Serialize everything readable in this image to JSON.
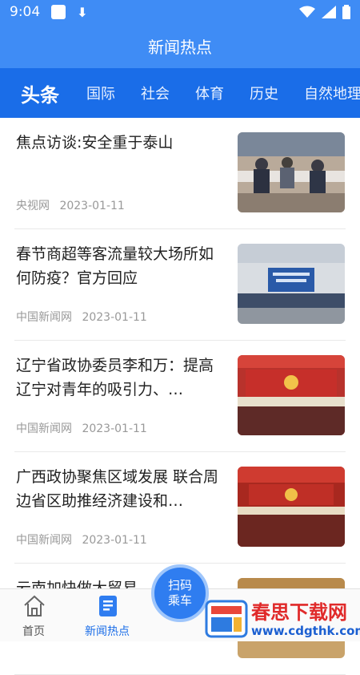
{
  "status_bar": {
    "time": "9:04"
  },
  "header": {
    "title": "新闻热点"
  },
  "tabs": [
    {
      "label": "头条",
      "active": true
    },
    {
      "label": "国际"
    },
    {
      "label": "社会"
    },
    {
      "label": "体育"
    },
    {
      "label": "历史"
    },
    {
      "label": "自然地理"
    }
  ],
  "articles": [
    {
      "title": "焦点访谈:安全重于泰山",
      "source": "央视网",
      "date": "2023-01-11"
    },
    {
      "title": "春节商超等客流量较大场所如何防疫？官方回应",
      "source": "中国新闻网",
      "date": "2023-01-11"
    },
    {
      "title": "辽宁省政协委员李和万：提高辽宁对青年的吸引力、…",
      "source": "中国新闻网",
      "date": "2023-01-11"
    },
    {
      "title": "广西政协聚焦区域发展 联合周边省区助推经济建设和…",
      "source": "中国新闻网",
      "date": "2023-01-11"
    },
    {
      "title": "云南加快做大贸易…进",
      "source": "",
      "date": ""
    }
  ],
  "scan_button": {
    "line1": "扫码",
    "line2": "乘车"
  },
  "bottom_nav": [
    {
      "label": "首页",
      "icon": "home-icon"
    },
    {
      "label": "新闻热点",
      "icon": "news-icon",
      "active": true
    }
  ],
  "watermark": {
    "title": "春思下载网",
    "url": "www.cdgthk.com"
  },
  "colors": {
    "primary": "#3f8cf5",
    "tab_bar": "#1a6de8",
    "meta": "#999999"
  }
}
